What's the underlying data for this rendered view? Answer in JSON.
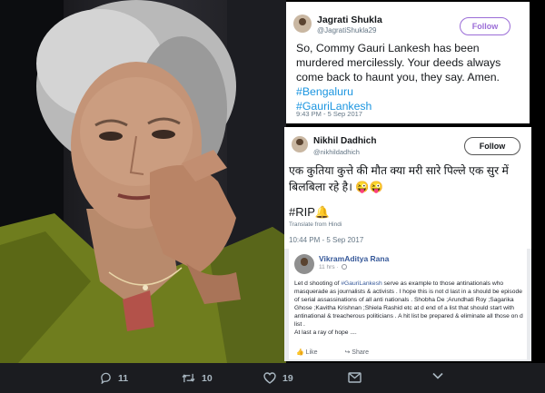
{
  "photo": {
    "subject": "woman-portrait"
  },
  "tweet1": {
    "name": "Jagrati Shukla",
    "handle": "@JagratiShukla29",
    "follow_label": "Follow",
    "text": "So, Commy Gauri Lankesh has been murdered mercilessly. Your deeds always come back to haunt you, they say. Amen.",
    "tags": [
      "#Bengaluru",
      "#GauriLankesh"
    ],
    "timestamp": "9:43 PM - 5 Sep 2017"
  },
  "tweet2": {
    "name": "Nikhil Dadhich",
    "handle": "@nikhildadhich",
    "follow_label": "Follow",
    "text": "एक कुतिया कुत्ते की मौत क्या मरी सारे पिल्ले एक सुर में बिलबिला रहे है। 😜😜",
    "rip": "#RIP🔔",
    "translate": "Translate from Hindi",
    "timestamp": "10:44 PM - 5 Sep 2017"
  },
  "post3": {
    "name": "VikramAditya Rana",
    "time": "11 hrs",
    "body_before": "Let d shooting of ",
    "tag": "#GauriLankesh",
    "body_after": " serve as example to those antinationals who masquerade as journalists & activists . I hope this is not d last in a should be episode of serial assassinations of all anti nationals . Shobha De ;Arundhati Roy ;Sagarika Ghose ;Kavitha Krishnan ;Shiela Rashid etc at d end of a list that should start with antinational & treacherous politicians . A hit list be prepared & eliminate all those on d list .",
    "body_last": "At last a ray of hope ....",
    "like_label": "Like",
    "share_label": "Share"
  },
  "actions": {
    "reply_count": "11",
    "retweet_count": "10",
    "like_count": "19"
  },
  "colors": {
    "twitter_blue": "#1da1f2",
    "hashtag": "#1b95e0",
    "bar_bg": "#1b1c20",
    "icon_gray": "#aab8c2"
  }
}
